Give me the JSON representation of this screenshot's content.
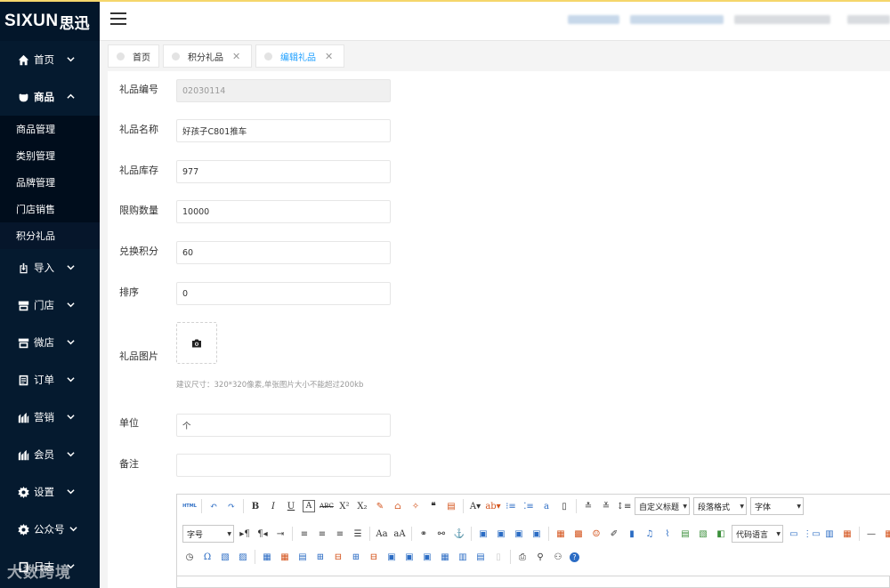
{
  "logo": {
    "en": "SIXUN",
    "cn": "思迅"
  },
  "nav": {
    "home": "首页",
    "goods": "商品",
    "goods_sub": [
      "商品管理",
      "类别管理",
      "品牌管理",
      "门店销售",
      "积分礼品"
    ],
    "import": "导入",
    "store": "门店",
    "microstore": "微店",
    "orders": "订单",
    "marketing": "营销",
    "members": "会员",
    "settings": "设置",
    "official": "公众号",
    "log": "日志"
  },
  "tabs": [
    {
      "label": "首页",
      "closable": false
    },
    {
      "label": "积分礼品",
      "closable": true
    },
    {
      "label": "编辑礼品",
      "closable": true
    }
  ],
  "form": {
    "gift_code_label": "礼品编号",
    "gift_code_value": "02030114",
    "gift_name_label": "礼品名称",
    "gift_name_value": "好孩子C801推车",
    "stock_label": "礼品库存",
    "stock_value": "977",
    "limit_label": "限购数量",
    "limit_value": "10000",
    "points_label": "兑换积分",
    "points_value": "60",
    "sort_label": "排序",
    "sort_value": "0",
    "image_label": "礼品图片",
    "image_hint": "建议尺寸：320*320像素,单张图片大小不能超过200kb",
    "unit_label": "单位",
    "unit_value": "个",
    "remark_label": "备注",
    "remark_value": ""
  },
  "editor": {
    "html_label": "HTML",
    "custom_title": "自定义标题",
    "paragraph": "段落格式",
    "font_family": "字体",
    "font_size": "字号",
    "code_lang": "代码语言"
  },
  "watermark": "大数跨境",
  "colors": {
    "sidebar": "#051a2f",
    "accent": "#1e9fff",
    "topstrip": "#f5d66b"
  }
}
